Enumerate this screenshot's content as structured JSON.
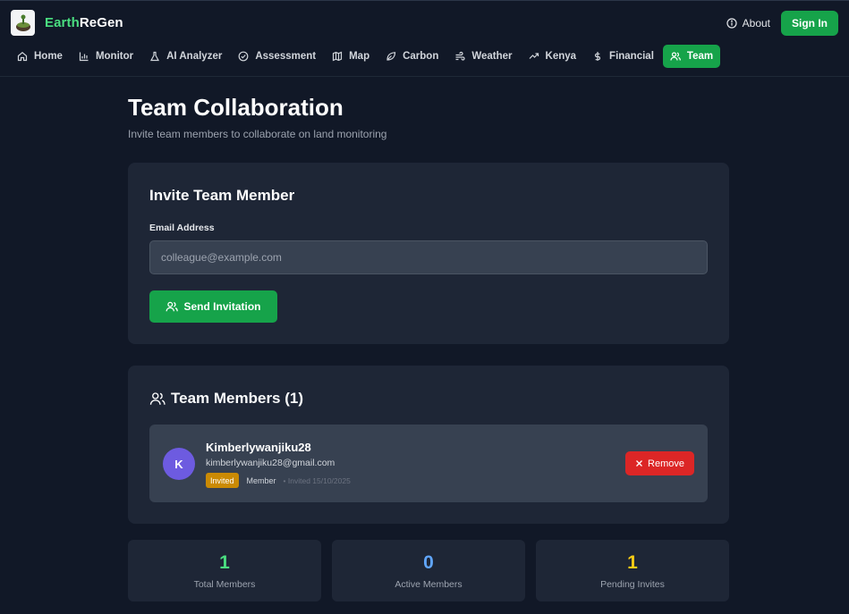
{
  "brand": {
    "name_part1": "Earth",
    "name_part2": "ReGen"
  },
  "header": {
    "about_label": "About",
    "signin_label": "Sign In"
  },
  "nav": {
    "items": [
      {
        "label": "Home",
        "icon": "home-icon"
      },
      {
        "label": "Monitor",
        "icon": "bar-chart-icon"
      },
      {
        "label": "AI Analyzer",
        "icon": "flask-icon"
      },
      {
        "label": "Assessment",
        "icon": "check-circle-icon"
      },
      {
        "label": "Map",
        "icon": "map-icon"
      },
      {
        "label": "Carbon",
        "icon": "leaf-icon"
      },
      {
        "label": "Weather",
        "icon": "wind-icon"
      },
      {
        "label": "Kenya",
        "icon": "trending-up-icon"
      },
      {
        "label": "Financial",
        "icon": "dollar-icon"
      },
      {
        "label": "Team",
        "icon": "users-icon",
        "active": true
      }
    ]
  },
  "page": {
    "title": "Team Collaboration",
    "subtitle": "Invite team members to collaborate on land monitoring"
  },
  "invite": {
    "title": "Invite Team Member",
    "email_label": "Email Address",
    "email_value": "",
    "email_placeholder": "colleague@example.com",
    "send_label": "Send Invitation"
  },
  "members": {
    "title": "Team Members (1)",
    "list": [
      {
        "initial": "K",
        "name": "Kimberlywanjiku28",
        "email": "kimberlywanjiku28@gmail.com",
        "status": "Invited",
        "role": "Member",
        "invited_date": "• Invited 15/10/2025",
        "remove_label": "Remove"
      }
    ]
  },
  "stats": [
    {
      "value": "1",
      "label": "Total Members",
      "color": "#4ade80"
    },
    {
      "value": "0",
      "label": "Active Members",
      "color": "#60a5fa"
    },
    {
      "value": "1",
      "label": "Pending Invites",
      "color": "#facc15"
    }
  ],
  "colors": {
    "accent": "#16a34a",
    "danger": "#dc2626",
    "warning": "#ca8a04",
    "background": "#111827",
    "card": "#1e2636"
  }
}
